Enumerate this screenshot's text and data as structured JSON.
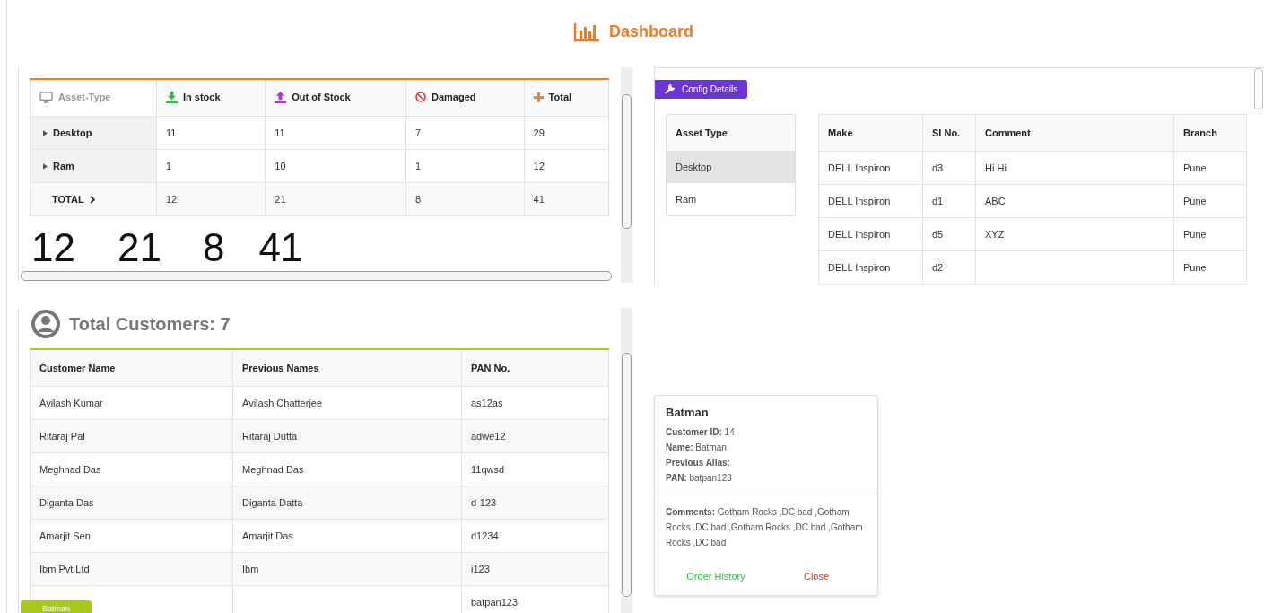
{
  "header": {
    "title": "Dashboard"
  },
  "asset_table": {
    "row_header": {
      "label": "Asset-Type"
    },
    "columns": [
      {
        "label": "In stock",
        "kind": "in"
      },
      {
        "label": "Out of Stock",
        "kind": "out"
      },
      {
        "label": "Damaged",
        "kind": "damaged"
      },
      {
        "label": "Total",
        "kind": "total"
      }
    ],
    "rows": [
      {
        "name": "Desktop",
        "expanded": false,
        "cells": [
          "11",
          "11",
          "7",
          "29"
        ]
      },
      {
        "name": "Ram",
        "expanded": false,
        "cells": [
          "1",
          "10",
          "1",
          "12"
        ]
      }
    ],
    "total_row": {
      "label": "TOTAL",
      "cells": [
        "12",
        "21",
        "8",
        "41"
      ]
    }
  },
  "big_totals": [
    "12",
    "21",
    "8",
    "41"
  ],
  "config": {
    "tab": "Config Details",
    "asset_types": {
      "header": "Asset Type",
      "items": [
        {
          "label": "Desktop",
          "selected": true
        },
        {
          "label": "Ram",
          "selected": false
        }
      ]
    },
    "table": {
      "columns": [
        "Make",
        "SI No.",
        "Comment",
        "Branch"
      ],
      "rows": [
        [
          "DELL Inspiron",
          "d3",
          "Hi Hi",
          "Pune"
        ],
        [
          "DELL Inspiron",
          "d1",
          "ABC",
          "Pune"
        ],
        [
          "DELL Inspiron",
          "d5",
          "XYZ",
          "Pune"
        ],
        [
          "DELL Inspiron",
          "d2",
          "",
          "Pune"
        ]
      ]
    }
  },
  "customers": {
    "title": "Total Customers: 7",
    "columns": [
      "Customer Name",
      "Previous Names",
      "PAN No."
    ],
    "rows": [
      {
        "name": "Avilash Kumar",
        "previous": "Avilash Chatterjee",
        "pan": "as12as",
        "selected": false
      },
      {
        "name": "Ritaraj Pal",
        "previous": "Ritaraj Dutta",
        "pan": "adwe12",
        "selected": false
      },
      {
        "name": "Meghnad Das",
        "previous": "Meghnad Das",
        "pan": "11qwsd",
        "selected": false
      },
      {
        "name": "Diganta Das",
        "previous": "Diganta Datta",
        "pan": "d-123",
        "selected": false
      },
      {
        "name": "Amarjit Sen",
        "previous": "Amarjit Das",
        "pan": "d1234",
        "selected": false
      },
      {
        "name": "Ibm Pvt Ltd",
        "previous": "Ibm",
        "pan": "i123",
        "selected": false
      },
      {
        "name": "Batman",
        "previous": "",
        "pan": "batpan123",
        "selected": true
      }
    ]
  },
  "popover": {
    "title": "Batman",
    "fields": [
      "**Customer ID:** 14",
      "**Name:** Batman",
      "**Previous Alias:**",
      "**PAN:** batpan123"
    ],
    "comments": "**Comments:** Gotham Rocks ,DC bad ,Gotham Rocks ,DC bad ,Gotham Rocks ,DC bad ,Gotham Rocks ,DC bad",
    "actions": [
      {
        "label": "Order History",
        "kind": "primary"
      },
      {
        "label": "Close",
        "kind": "danger"
      }
    ]
  }
}
